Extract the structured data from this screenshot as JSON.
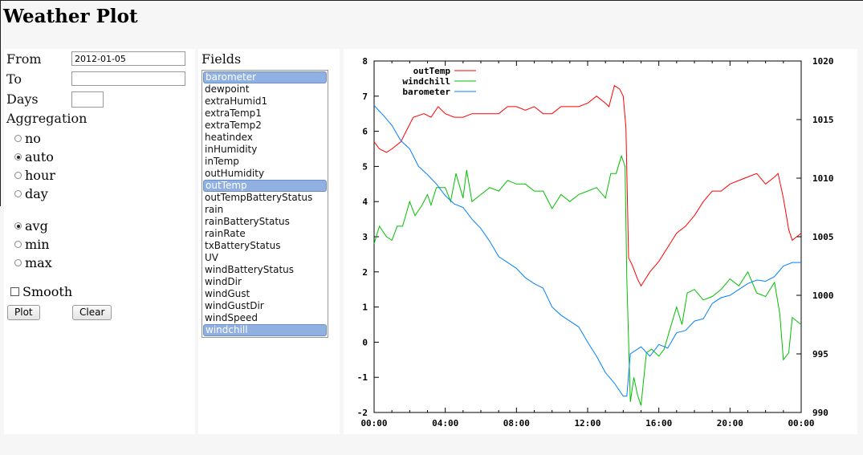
{
  "title": "Weather Plot",
  "form": {
    "from_label": "From",
    "from_value": "2012-01-05",
    "to_label": "To",
    "to_value": "",
    "days_label": "Days",
    "days_value": "",
    "aggregation_label": "Aggregation",
    "aggregation_options": [
      {
        "label": "no",
        "checked": false
      },
      {
        "label": "auto",
        "checked": true
      },
      {
        "label": "hour",
        "checked": false
      },
      {
        "label": "day",
        "checked": false
      }
    ],
    "func_options": [
      {
        "label": "avg",
        "checked": true
      },
      {
        "label": "min",
        "checked": false
      },
      {
        "label": "max",
        "checked": false
      }
    ],
    "smooth_label": "Smooth",
    "smooth_checked": false,
    "plot_button": "Plot",
    "clear_button": "Clear"
  },
  "fields": {
    "label": "Fields",
    "items": [
      {
        "label": "barometer",
        "selected": true
      },
      {
        "label": "dewpoint",
        "selected": false
      },
      {
        "label": "extraHumid1",
        "selected": false
      },
      {
        "label": "extraTemp1",
        "selected": false
      },
      {
        "label": "extraTemp2",
        "selected": false
      },
      {
        "label": "heatindex",
        "selected": false
      },
      {
        "label": "inHumidity",
        "selected": false
      },
      {
        "label": "inTemp",
        "selected": false
      },
      {
        "label": "outHumidity",
        "selected": false
      },
      {
        "label": "outTemp",
        "selected": true
      },
      {
        "label": "outTempBatteryStatus",
        "selected": false
      },
      {
        "label": "rain",
        "selected": false
      },
      {
        "label": "rainBatteryStatus",
        "selected": false
      },
      {
        "label": "rainRate",
        "selected": false
      },
      {
        "label": "txBatteryStatus",
        "selected": false
      },
      {
        "label": "UV",
        "selected": false
      },
      {
        "label": "windBatteryStatus",
        "selected": false
      },
      {
        "label": "windDir",
        "selected": false
      },
      {
        "label": "windGust",
        "selected": false
      },
      {
        "label": "windGustDir",
        "selected": false
      },
      {
        "label": "windSpeed",
        "selected": false
      },
      {
        "label": "windchill",
        "selected": true
      }
    ]
  },
  "chart_data": {
    "type": "line",
    "title": "",
    "xlabel": "",
    "ylabel": "",
    "y2label": "",
    "xlim": [
      0,
      24
    ],
    "ylim": [
      -2,
      8
    ],
    "y2lim": [
      990,
      1020
    ],
    "x_ticks": [
      "00:00",
      "04:00",
      "08:00",
      "12:00",
      "16:00",
      "20:00",
      "00:00"
    ],
    "y_ticks": [
      "-2",
      "-1",
      "0",
      "1",
      "2",
      "3",
      "4",
      "5",
      "6",
      "7",
      "8"
    ],
    "y2_ticks": [
      "990",
      "995",
      "1000",
      "1005",
      "1010",
      "1015",
      "1020"
    ],
    "grid": false,
    "legend": "top-left",
    "series": [
      {
        "name": "outTemp",
        "axis": "left",
        "color": "#ff0000",
        "x": [
          0,
          0.3,
          0.7,
          1,
          1.5,
          1.8,
          2.2,
          2.8,
          3.2,
          3.6,
          4,
          4.5,
          5,
          5.5,
          7,
          7.5,
          8,
          8.5,
          9,
          9.5,
          10,
          10.5,
          11,
          11.5,
          12,
          12.5,
          13,
          13.2,
          13.5,
          13.8,
          14,
          14.15,
          14.3,
          14.5,
          14.8,
          15,
          15.5,
          16,
          16.5,
          17,
          17.5,
          18,
          18.5,
          19,
          19.5,
          20,
          20.5,
          21,
          21.5,
          22,
          22.5,
          22.7,
          23,
          23.3,
          23.5,
          24
        ],
        "y": [
          5.7,
          5.5,
          5.4,
          5.5,
          5.7,
          6.0,
          6.4,
          6.5,
          6.4,
          6.7,
          6.5,
          6.4,
          6.4,
          6.5,
          6.5,
          6.7,
          6.7,
          6.6,
          6.7,
          6.5,
          6.5,
          6.7,
          6.7,
          6.7,
          6.8,
          7.0,
          6.8,
          6.7,
          7.3,
          7.2,
          7.0,
          6.1,
          2.4,
          2.2,
          1.8,
          1.6,
          2.0,
          2.3,
          2.7,
          3.1,
          3.3,
          3.6,
          4.0,
          4.3,
          4.3,
          4.5,
          4.6,
          4.7,
          4.8,
          4.5,
          4.7,
          4.8,
          4.1,
          3.2,
          2.9,
          3.1
        ]
      },
      {
        "name": "windchill",
        "axis": "left",
        "color": "#00c000",
        "x": [
          0,
          0.3,
          0.7,
          1,
          1.3,
          1.6,
          2,
          2.3,
          2.7,
          3,
          3.2,
          3.5,
          4,
          4.3,
          4.6,
          5,
          5.2,
          5.5,
          6,
          6.5,
          7,
          7.5,
          8,
          8.5,
          9,
          9.5,
          10,
          10.5,
          11,
          11.5,
          12,
          12.5,
          13,
          13.3,
          13.6,
          13.9,
          14.1,
          14.2,
          14.4,
          14.6,
          14.8,
          15,
          15.3,
          15.6,
          16,
          16.3,
          16.7,
          17,
          17.3,
          17.6,
          18,
          18.5,
          19,
          19.5,
          20,
          20.5,
          21,
          21.5,
          22,
          22.5,
          22.8,
          23,
          23.3,
          23.5,
          24
        ],
        "y": [
          2.8,
          3.3,
          3.0,
          2.9,
          3.3,
          3.3,
          4.0,
          3.6,
          3.9,
          4.2,
          3.9,
          4.4,
          4.4,
          4.0,
          4.8,
          4.1,
          4.9,
          4.0,
          4.2,
          4.4,
          4.3,
          4.6,
          4.5,
          4.5,
          4.3,
          4.3,
          3.8,
          4.2,
          4.0,
          4.2,
          4.3,
          4.4,
          4.1,
          4.8,
          4.8,
          5.3,
          5.0,
          1.8,
          -1.7,
          -1.0,
          -1.5,
          -1.8,
          -0.3,
          -0.2,
          -0.4,
          -0.2,
          0.5,
          1.0,
          0.5,
          1.4,
          1.5,
          1.2,
          1.3,
          1.5,
          1.8,
          1.6,
          2.0,
          1.4,
          1.3,
          1.7,
          0.8,
          -0.5,
          -0.3,
          0.7,
          0.5
        ]
      },
      {
        "name": "barometer",
        "axis": "right",
        "color": "#0080ff",
        "x": [
          0,
          0.5,
          1,
          1.5,
          2,
          2.5,
          3,
          3.5,
          4,
          4.5,
          5,
          5.5,
          6,
          6.5,
          7,
          7.5,
          8,
          8.5,
          9,
          9.5,
          10,
          10.5,
          11,
          11.5,
          12,
          12.5,
          13,
          13.5,
          14,
          14.2,
          14.4,
          15,
          15.5,
          16,
          16.5,
          17,
          17.5,
          18,
          18.5,
          19,
          19.5,
          20,
          20.5,
          21,
          21.5,
          22,
          22.5,
          23,
          23.5,
          24
        ],
        "y": [
          1016.2,
          1015.4,
          1014.5,
          1013.2,
          1012.5,
          1011.0,
          1010.3,
          1009.5,
          1008.5,
          1007.8,
          1007.5,
          1006.5,
          1005.7,
          1004.6,
          1003.3,
          1002.8,
          1002.3,
          1001.5,
          1001.0,
          1000.6,
          999.0,
          998.3,
          997.8,
          997.3,
          996.0,
          994.8,
          993.4,
          992.5,
          991.4,
          991.4,
          995.0,
          995.6,
          994.8,
          995.8,
          995.5,
          996.8,
          997.0,
          997.8,
          998.0,
          999.3,
          999.8,
          1000.0,
          1000.5,
          1001.0,
          1001.3,
          1001.2,
          1001.6,
          1002.5,
          1002.8,
          1002.8
        ]
      }
    ]
  }
}
